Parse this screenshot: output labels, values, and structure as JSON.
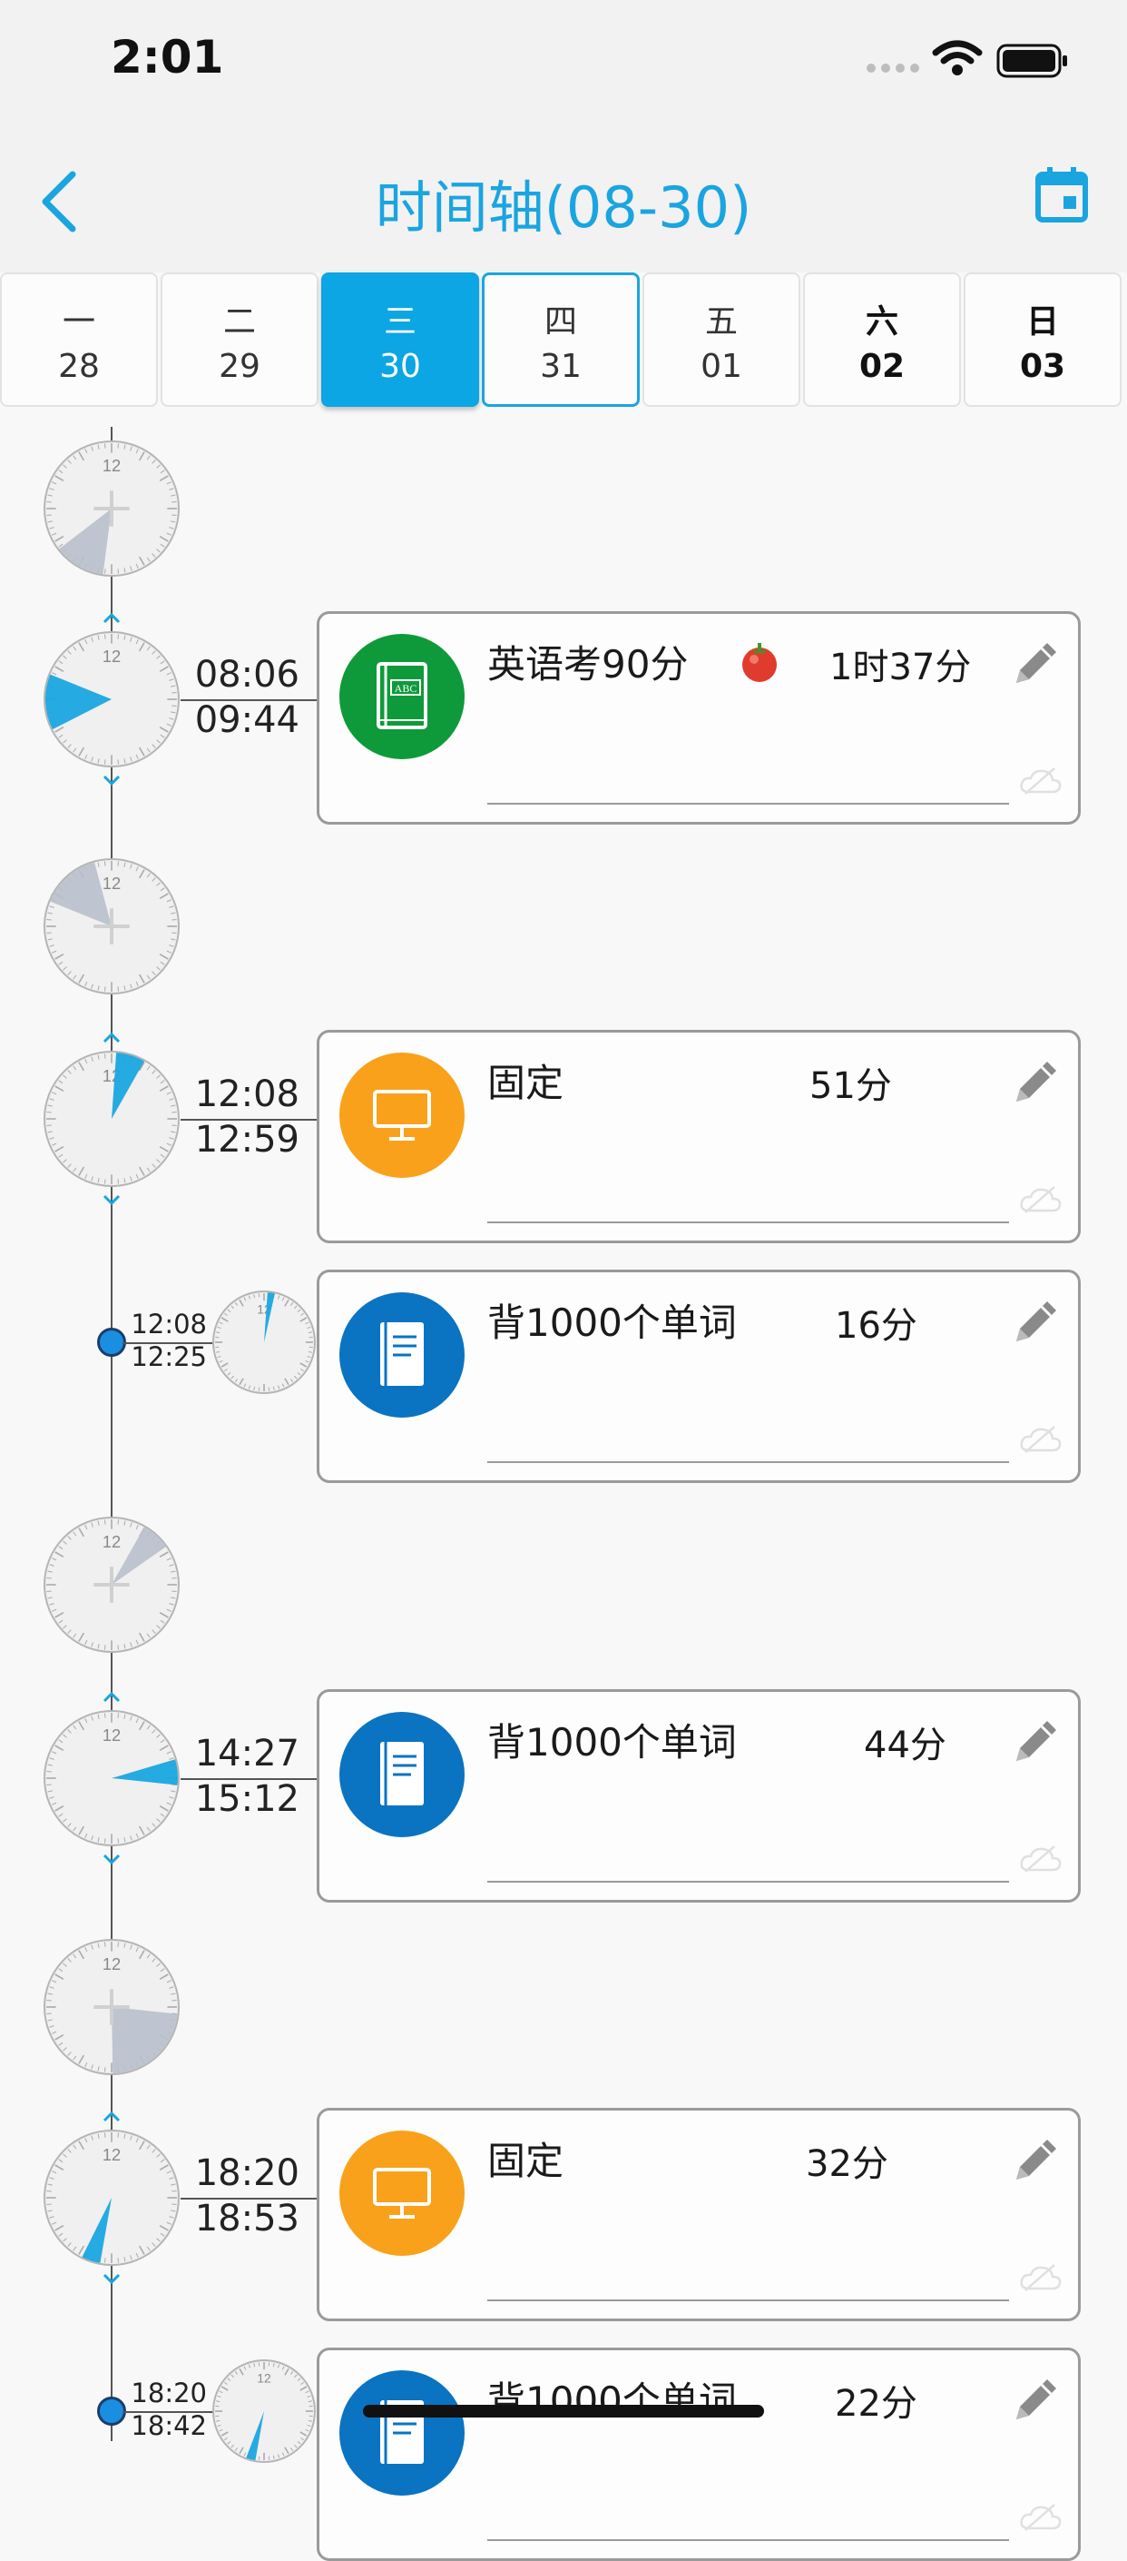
{
  "status": {
    "time": "2:01"
  },
  "nav": {
    "title": "时间轴(08-30)",
    "back_icon": "chevron-left-icon",
    "calendar_icon": "calendar-icon"
  },
  "week": [
    {
      "wd": "一",
      "date": "28"
    },
    {
      "wd": "二",
      "date": "29"
    },
    {
      "wd": "三",
      "date": "30",
      "selected": true
    },
    {
      "wd": "四",
      "date": "31",
      "today": true
    },
    {
      "wd": "五",
      "date": "01"
    },
    {
      "wd": "六",
      "date": "02"
    },
    {
      "wd": "日",
      "date": "03"
    }
  ],
  "clock_label": "12",
  "entries": [
    {
      "title": "英语考90分",
      "duration": "1时37分",
      "start": "08:06",
      "end": "09:44",
      "icon": "abc-book-icon",
      "color": "#0e9a3a",
      "tomato": true
    },
    {
      "title": "固定",
      "duration": "51分",
      "start": "12:08",
      "end": "12:59",
      "icon": "monitor-icon",
      "color": "#f9a11b"
    },
    {
      "title": "背1000个单词",
      "duration": "16分",
      "start": "12:08",
      "end": "12:25",
      "icon": "book-icon",
      "color": "#0a73c2"
    },
    {
      "title": "背1000个单词",
      "duration": "44分",
      "start": "14:27",
      "end": "15:12",
      "icon": "book-icon",
      "color": "#0a73c2"
    },
    {
      "title": "固定",
      "duration": "32分",
      "start": "18:20",
      "end": "18:53",
      "icon": "monitor-icon",
      "color": "#f9a11b"
    },
    {
      "title": "背1000个单词",
      "duration": "22分",
      "start": "18:20",
      "end": "18:42",
      "icon": "book-icon",
      "color": "#0a73c2"
    }
  ],
  "colors": {
    "accent": "#1aa5e0",
    "selected_day": "#0ba6e3",
    "gap_sector": "#b8c0cc",
    "entry_sector": "#1aa5e0"
  }
}
